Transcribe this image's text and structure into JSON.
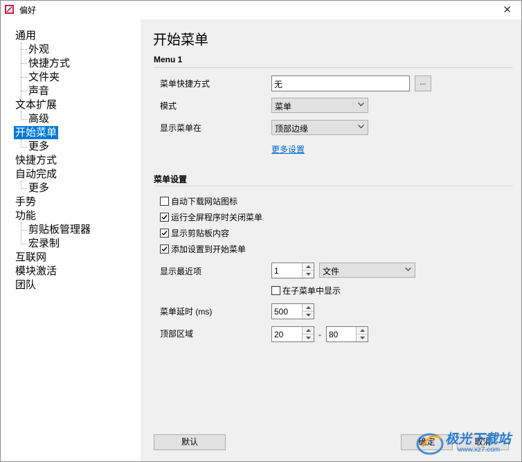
{
  "window": {
    "title": "偏好",
    "close_glyph": "✕"
  },
  "sidebar": {
    "items": [
      {
        "label": "通用"
      },
      {
        "label": "外观"
      },
      {
        "label": "快捷方式"
      },
      {
        "label": "文件夹"
      },
      {
        "label": "声音"
      },
      {
        "label": "文本扩展"
      },
      {
        "label": "高级"
      },
      {
        "label": "开始菜单"
      },
      {
        "label": "更多"
      },
      {
        "label": "快捷方式"
      },
      {
        "label": "自动完成"
      },
      {
        "label": "更多"
      },
      {
        "label": "手势"
      },
      {
        "label": "功能"
      },
      {
        "label": "剪贴板管理器"
      },
      {
        "label": "宏录制"
      },
      {
        "label": "互联网"
      },
      {
        "label": "模块激活"
      },
      {
        "label": "团队"
      }
    ],
    "selected": "开始菜单",
    "accent_color": "#0078d7"
  },
  "main": {
    "page_title": "开始菜单",
    "section1": {
      "title": "Menu 1",
      "shortcut_label": "菜单快捷方式",
      "shortcut_value": "无",
      "shortcut_button": "...",
      "mode_label": "模式",
      "mode_value": "菜单",
      "show_at_label": "显示菜单在",
      "show_at_value": "顶部边缘",
      "more_settings_link": "更多设置"
    },
    "section2": {
      "title": "菜单设置",
      "checkboxes": [
        {
          "label": "自动下载网站图标",
          "checked": false
        },
        {
          "label": "运行全屏程序时关闭菜单",
          "checked": true
        },
        {
          "label": "显示剪贴板内容",
          "checked": true
        },
        {
          "label": "添加设置到开始菜单",
          "checked": true
        }
      ],
      "recent_label": "显示最近项",
      "recent_count": "1",
      "recent_type": "文件",
      "submenu_checkbox": {
        "label": "在子菜单中显示",
        "checked": false
      },
      "delay_label": "菜单延时 (ms)",
      "delay_value": "500",
      "top_area_label": "顶部区域",
      "top_area_from": "20",
      "top_area_dash": "-",
      "top_area_to": "80"
    },
    "buttons": {
      "default": "默认",
      "ok": "确定",
      "cancel": "取消"
    }
  },
  "watermark": {
    "text": "极光下载站",
    "url": "www.xz7.com"
  }
}
